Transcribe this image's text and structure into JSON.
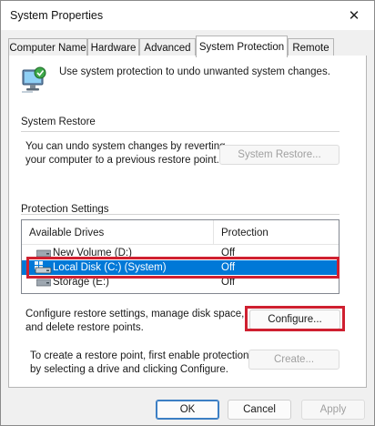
{
  "window": {
    "title": "System Properties",
    "close_glyph": "✕"
  },
  "tabs": [
    {
      "label": "Computer Name"
    },
    {
      "label": "Hardware"
    },
    {
      "label": "Advanced"
    },
    {
      "label": "System Protection",
      "active": true
    },
    {
      "label": "Remote"
    }
  ],
  "intro": {
    "icon": "computer-shield-icon",
    "text": "Use system protection to undo unwanted system changes."
  },
  "system_restore": {
    "title": "System Restore",
    "description_line1": "You can undo system changes by reverting",
    "description_line2": "your computer to a previous restore point.",
    "button_label": "System Restore..."
  },
  "protection_settings": {
    "title": "Protection Settings",
    "columns": [
      "Available Drives",
      "Protection"
    ],
    "drives": [
      {
        "name": "New Volume (D:)",
        "protection": "Off",
        "icon": "drive-icon",
        "selected": false
      },
      {
        "name": "Local Disk (C:) (System)",
        "protection": "Off",
        "icon": "system-drive-icon",
        "selected": true
      },
      {
        "name": "Storage (E:)",
        "protection": "Off",
        "icon": "drive-icon",
        "selected": false
      }
    ],
    "configure_line1": "Configure restore settings, manage disk space,",
    "configure_line2": "and delete restore points.",
    "configure_button": "Configure...",
    "create_line1": "To create a restore point, first enable protection",
    "create_line2": "by selecting a drive and clicking Configure.",
    "create_button": "Create..."
  },
  "footer": {
    "ok": "OK",
    "cancel": "Cancel",
    "apply": "Apply"
  },
  "colors": {
    "selection": "#0078d7",
    "highlight_box": "#cf2030"
  }
}
